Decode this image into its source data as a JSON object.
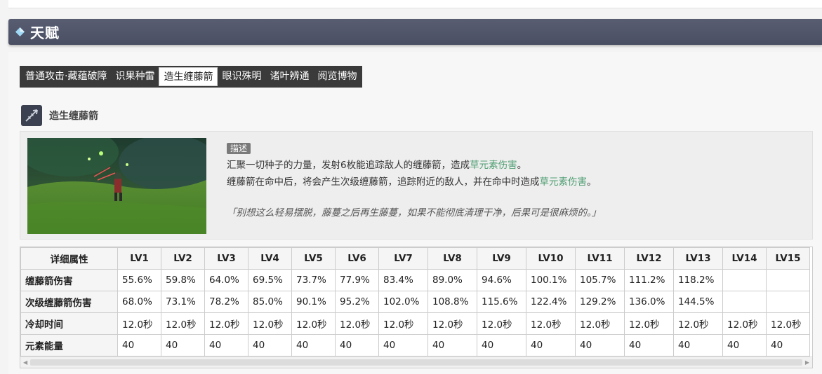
{
  "section": {
    "title": "天赋"
  },
  "tabs": [
    "普通攻击·藏蕴破障",
    "识果种雷",
    "造生缠藤箭",
    "眼识殊明",
    "诸叶辨通",
    "阅览博物"
  ],
  "active_tab": "造生缠藤箭",
  "skill": {
    "name": "造生缠藤箭",
    "desc_badge": "描述",
    "line1_pre": "汇聚一切种子的力量，发射6枚能追踪敌人的缠藤箭，造成",
    "line1_hl": "草元素伤害",
    "line1_post": "。",
    "line2_pre": "缠藤箭在命中后，将会产生次级缠藤箭，追踪附近的敌人，并在命中时造成",
    "line2_hl": "草元素伤害",
    "line2_post": "。",
    "quote": "「别想这么轻易摆脱，藤蔓之后再生藤蔓，如果不能彻底清理干净，后果可是很麻烦的。」"
  },
  "table": {
    "header": [
      "详细属性",
      "LV1",
      "LV2",
      "LV3",
      "LV4",
      "LV5",
      "LV6",
      "LV7",
      "LV8",
      "LV9",
      "LV10",
      "LV11",
      "LV12",
      "LV13",
      "LV14",
      "LV15"
    ],
    "rows": [
      [
        "缠藤箭伤害",
        "55.6%",
        "59.8%",
        "64.0%",
        "69.5%",
        "73.7%",
        "77.9%",
        "83.4%",
        "89.0%",
        "94.6%",
        "100.1%",
        "105.7%",
        "111.2%",
        "118.2%",
        "",
        ""
      ],
      [
        "次级缠藤箭伤害",
        "68.0%",
        "73.1%",
        "78.2%",
        "85.0%",
        "90.1%",
        "95.2%",
        "102.0%",
        "108.8%",
        "115.6%",
        "122.4%",
        "129.2%",
        "136.0%",
        "144.5%",
        "",
        ""
      ],
      [
        "冷却时间",
        "12.0秒",
        "12.0秒",
        "12.0秒",
        "12.0秒",
        "12.0秒",
        "12.0秒",
        "12.0秒",
        "12.0秒",
        "12.0秒",
        "12.0秒",
        "12.0秒",
        "12.0秒",
        "12.0秒",
        "12.0秒",
        "12.0秒"
      ],
      [
        "元素能量",
        "40",
        "40",
        "40",
        "40",
        "40",
        "40",
        "40",
        "40",
        "40",
        "40",
        "40",
        "40",
        "40",
        "40",
        "40"
      ]
    ]
  },
  "colors": {
    "header_bg": "#4f5468",
    "accent_diamond": "#7ec8f0",
    "dendro": "#4f9e72"
  }
}
